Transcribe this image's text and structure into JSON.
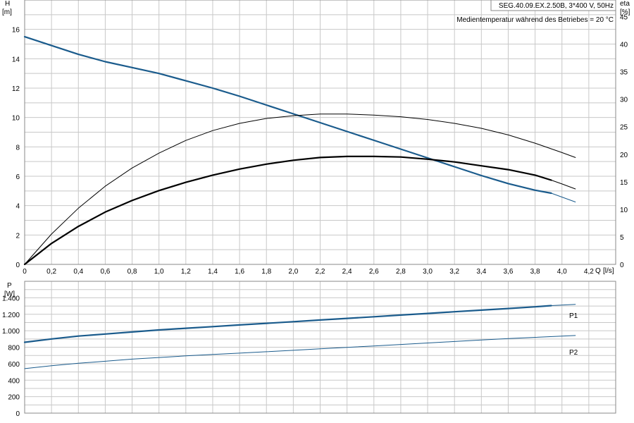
{
  "header": {
    "pump_label": "SEG.40.09.EX.2.50B, 3*400 V, 50Hz",
    "temperature_note": "Medientemperatur während des Betriebes = 20 °C"
  },
  "chart_data": [
    {
      "type": "line",
      "ylabel": "H",
      "yunit": "[m]",
      "y2label": "eta",
      "y2unit": "[%]",
      "xlabel": "Q",
      "xunit": "[l/s]",
      "xlim": [
        0,
        4.4
      ],
      "ylim": [
        0,
        18
      ],
      "y2lim": [
        0,
        48
      ],
      "x_ticks": [
        "0",
        "0,2",
        "0,4",
        "0,6",
        "0,8",
        "1,0",
        "1,2",
        "1,4",
        "1,6",
        "1,8",
        "2,0",
        "2,2",
        "2,4",
        "2,6",
        "2,8",
        "3,0",
        "3,2",
        "3,4",
        "3,6",
        "3,8",
        "4,0",
        "4,2"
      ],
      "y_ticks": [
        "0",
        "2",
        "4",
        "6",
        "8",
        "10",
        "12",
        "14",
        "16"
      ],
      "y2_ticks": [
        "0",
        "5",
        "10",
        "15",
        "20",
        "25",
        "30",
        "35",
        "40",
        "45"
      ],
      "grid": true,
      "series": [
        {
          "axis": "left",
          "color": "#1a5b8c",
          "width": 2.2,
          "x": [
            0,
            0.2,
            0.4,
            0.6,
            0.8,
            1.0,
            1.2,
            1.4,
            1.6,
            1.8,
            2.0,
            2.2,
            2.4,
            2.6,
            2.8,
            3.0,
            3.2,
            3.4,
            3.6,
            3.8,
            3.92
          ],
          "y": [
            15.5,
            14.9,
            14.3,
            13.8,
            13.4,
            13.0,
            12.5,
            12.0,
            11.45,
            10.85,
            10.25,
            9.65,
            9.05,
            8.45,
            7.85,
            7.25,
            6.65,
            6.05,
            5.5,
            5.05,
            4.85
          ]
        },
        {
          "axis": "left",
          "color": "#1a5b8c",
          "width": 1,
          "x": [
            3.92,
            4.1
          ],
          "y": [
            4.85,
            4.25
          ]
        },
        {
          "axis": "right",
          "color": "#000000",
          "width": 1,
          "x": [
            0,
            0.2,
            0.4,
            0.6,
            0.8,
            1.0,
            1.2,
            1.4,
            1.6,
            1.8,
            2.0,
            2.2,
            2.4,
            2.6,
            2.8,
            3.0,
            3.2,
            3.4,
            3.6,
            3.8,
            4.0,
            4.1
          ],
          "y": [
            0,
            5.5,
            10.2,
            14.2,
            17.5,
            20.2,
            22.5,
            24.3,
            25.6,
            26.5,
            27.0,
            27.3,
            27.3,
            27.1,
            26.8,
            26.3,
            25.6,
            24.7,
            23.5,
            22.0,
            20.3,
            19.4
          ]
        },
        {
          "axis": "right",
          "color": "#000000",
          "width": 2.2,
          "x": [
            0,
            0.2,
            0.4,
            0.6,
            0.8,
            1.0,
            1.2,
            1.4,
            1.6,
            1.8,
            2.0,
            2.2,
            2.4,
            2.6,
            2.8,
            3.0,
            3.2,
            3.4,
            3.6,
            3.8,
            3.92
          ],
          "y": [
            0,
            3.8,
            6.9,
            9.5,
            11.6,
            13.4,
            14.9,
            16.2,
            17.3,
            18.2,
            18.9,
            19.4,
            19.6,
            19.6,
            19.5,
            19.1,
            18.6,
            17.9,
            17.2,
            16.2,
            15.3
          ]
        },
        {
          "axis": "right",
          "color": "#000000",
          "width": 1,
          "x": [
            3.92,
            4.0,
            4.1
          ],
          "y": [
            15.3,
            14.6,
            13.7
          ]
        }
      ]
    },
    {
      "type": "line",
      "ylabel": "P",
      "yunit": "[W]",
      "xlim": [
        0,
        4.4
      ],
      "ylim": [
        0,
        1600
      ],
      "y_ticks": [
        "0",
        "200",
        "400",
        "600",
        "800",
        "1.000",
        "1.200",
        "1.400"
      ],
      "grid": true,
      "series": [
        {
          "name": "P1",
          "color": "#1a5b8c",
          "width": 2.2,
          "x": [
            0,
            0.2,
            0.4,
            0.6,
            0.8,
            1.0,
            1.2,
            1.4,
            1.6,
            1.8,
            2.0,
            2.2,
            2.4,
            2.6,
            2.8,
            3.0,
            3.2,
            3.4,
            3.6,
            3.8,
            3.92
          ],
          "y": [
            860,
            900,
            935,
            960,
            985,
            1010,
            1030,
            1050,
            1070,
            1090,
            1110,
            1130,
            1150,
            1170,
            1190,
            1210,
            1230,
            1250,
            1270,
            1290,
            1305
          ]
        },
        {
          "color": "#1a5b8c",
          "width": 1,
          "x": [
            3.92,
            4.1
          ],
          "y": [
            1305,
            1320
          ]
        },
        {
          "name": "P2",
          "color": "#1a5b8c",
          "width": 1,
          "x": [
            0,
            0.2,
            0.4,
            0.6,
            0.8,
            1.0,
            1.2,
            1.4,
            1.6,
            1.8,
            2.0,
            2.2,
            2.4,
            2.6,
            2.8,
            3.0,
            3.2,
            3.4,
            3.6,
            3.8,
            4.0,
            4.1
          ],
          "y": [
            540,
            575,
            605,
            630,
            655,
            675,
            695,
            712,
            728,
            745,
            762,
            780,
            798,
            815,
            833,
            851,
            869,
            887,
            905,
            920,
            935,
            942
          ]
        }
      ]
    }
  ]
}
